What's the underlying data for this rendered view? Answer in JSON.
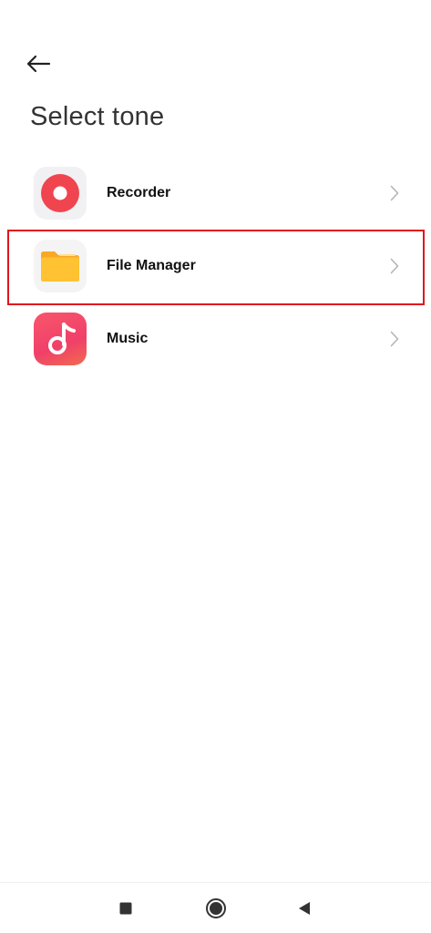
{
  "header": {
    "back_icon": "arrow-left-icon",
    "title": "Select tone"
  },
  "apps": [
    {
      "label": "Recorder",
      "icon": "recorder-icon",
      "color": "#f0454f"
    },
    {
      "label": "File Manager",
      "icon": "folder-icon",
      "color": "#fbb72a"
    },
    {
      "label": "Music",
      "icon": "music-note-icon",
      "color": "#f04f6b"
    }
  ],
  "highlight": {
    "color": "#e0141e"
  },
  "nav": {
    "recents_icon": "square-icon",
    "home_icon": "circle-icon",
    "back_icon": "triangle-back-icon"
  }
}
